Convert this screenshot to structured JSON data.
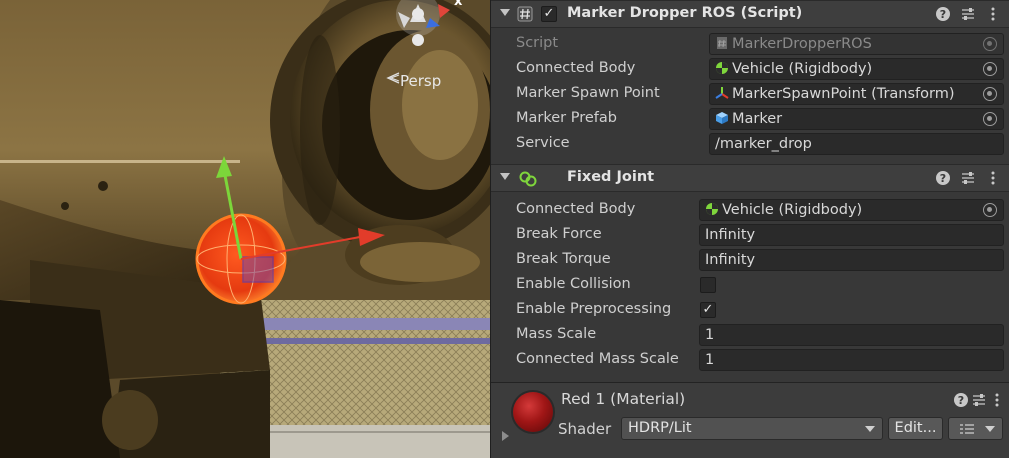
{
  "scene": {
    "camera_label": "Persp",
    "gizmo_axis_label": "x"
  },
  "marker_dropper": {
    "title": "Marker Dropper ROS (Script)",
    "enabled": true,
    "fields": {
      "script": {
        "label": "Script",
        "value": "MarkerDropperROS"
      },
      "connected_body": {
        "label": "Connected Body",
        "value": "Vehicle (Rigidbody)"
      },
      "marker_spawn_point": {
        "label": "Marker Spawn Point",
        "value": "MarkerSpawnPoint (Transform)"
      },
      "marker_prefab": {
        "label": "Marker Prefab",
        "value": "Marker"
      },
      "service": {
        "label": "Service",
        "value": "/marker_drop"
      }
    }
  },
  "fixed_joint": {
    "title": "Fixed Joint",
    "fields": {
      "connected_body": {
        "label": "Connected Body",
        "value": "Vehicle (Rigidbody)"
      },
      "break_force": {
        "label": "Break Force",
        "value": "Infinity"
      },
      "break_torque": {
        "label": "Break Torque",
        "value": "Infinity"
      },
      "enable_collision": {
        "label": "Enable Collision",
        "checked": false
      },
      "enable_preprocessing": {
        "label": "Enable Preprocessing",
        "checked": true
      },
      "mass_scale": {
        "label": "Mass Scale",
        "value": "1"
      },
      "connected_mass_scale": {
        "label": "Connected Mass Scale",
        "value": "1"
      }
    }
  },
  "material": {
    "title": "Red 1 (Material)",
    "shader_label": "Shader",
    "shader_value": "HDRP/Lit",
    "edit_button": "Edit...",
    "color": "#b01c1c"
  },
  "icons": {
    "help": "?",
    "presets": "⇵",
    "menu": "⋮",
    "check": "✓"
  }
}
